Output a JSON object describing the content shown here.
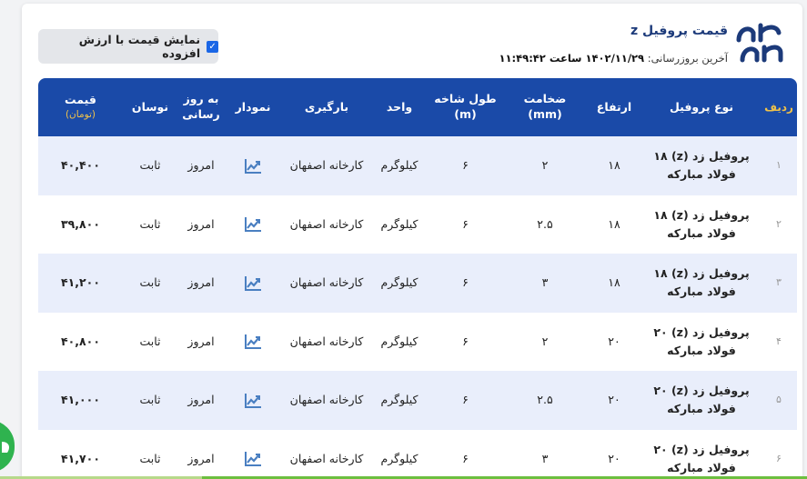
{
  "header": {
    "title": "قیمت پروفیل z",
    "last_update_label": "آخرین بروزرسانی:",
    "last_update_value": "۱۴۰۲/۱۱/۲۹ ساعت ۱۱:۴۹:۴۲"
  },
  "vat_toggle": {
    "label": "نمایش قیمت با ارزش افزوده",
    "checked": true
  },
  "table": {
    "headers": {
      "rownum": "ردیف",
      "type": "نوع پروفیل",
      "height": "ارتفاع",
      "thickness": "ضخامت",
      "thickness_unit": "(mm)",
      "length": "طول شاخه",
      "length_unit": "(m)",
      "unit": "واحد",
      "loading": "بارگیری",
      "chart": "نمودار",
      "updated": "به روز رسانی",
      "fluctuation": "نوسان",
      "price": "قیمت",
      "price_unit": "(تومان)"
    },
    "rows": [
      {
        "idx": "۱",
        "type": "پروفیل زد (z) ۱۸ فولاد مبارکه",
        "height": "۱۸",
        "thickness": "۲",
        "length": "۶",
        "unit": "کیلوگرم",
        "loading": "کارخانه اصفهان",
        "updated": "امروز",
        "fluctuation": "ثابت",
        "price": "۴۰,۴۰۰"
      },
      {
        "idx": "۲",
        "type": "پروفیل زد (z) ۱۸ فولاد مبارکه",
        "height": "۱۸",
        "thickness": "۲.۵",
        "length": "۶",
        "unit": "کیلوگرم",
        "loading": "کارخانه اصفهان",
        "updated": "امروز",
        "fluctuation": "ثابت",
        "price": "۳۹,۸۰۰"
      },
      {
        "idx": "۳",
        "type": "پروفیل زد (z) ۱۸ فولاد مبارکه",
        "height": "۱۸",
        "thickness": "۳",
        "length": "۶",
        "unit": "کیلوگرم",
        "loading": "کارخانه اصفهان",
        "updated": "امروز",
        "fluctuation": "ثابت",
        "price": "۴۱,۲۰۰"
      },
      {
        "idx": "۴",
        "type": "پروفیل زد (z) ۲۰ فولاد مبارکه",
        "height": "۲۰",
        "thickness": "۲",
        "length": "۶",
        "unit": "کیلوگرم",
        "loading": "کارخانه اصفهان",
        "updated": "امروز",
        "fluctuation": "ثابت",
        "price": "۴۰,۸۰۰"
      },
      {
        "idx": "۵",
        "type": "پروفیل زد (z) ۲۰ فولاد مبارکه",
        "height": "۲۰",
        "thickness": "۲.۵",
        "length": "۶",
        "unit": "کیلوگرم",
        "loading": "کارخانه اصفهان",
        "updated": "امروز",
        "fluctuation": "ثابت",
        "price": "۴۱,۰۰۰"
      },
      {
        "idx": "۶",
        "type": "پروفیل زد (z) ۲۰ فولاد مبارکه",
        "height": "۲۰",
        "thickness": "۳",
        "length": "۶",
        "unit": "کیلوگرم",
        "loading": "کارخانه اصفهان",
        "updated": "امروز",
        "fluctuation": "ثابت",
        "price": "۴۱,۷۰۰"
      }
    ]
  },
  "icons": {
    "logo": "brand-logo-icon",
    "chart": "trend-chart-icon",
    "floating": "whatsapp-icon"
  },
  "colors": {
    "primary": "#1a4aa8",
    "accent": "#f0c24a",
    "row_alt": "#e9eefb",
    "checkbox": "#1a66e6",
    "fab": "#2fb34f"
  }
}
